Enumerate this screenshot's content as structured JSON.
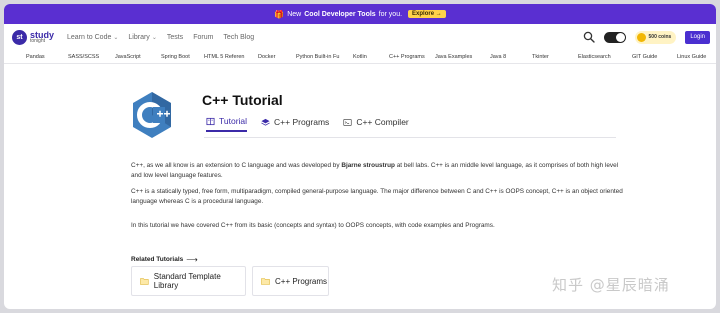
{
  "promo": {
    "prefix": "New",
    "highlight": "Cool Developer Tools",
    "suffix": "for you.",
    "button": "Explore →",
    "icon": "gift-icon"
  },
  "nav": {
    "logo_line1": "study",
    "logo_line2": "tonight",
    "logo_badge": "st",
    "links": [
      "Learn to Code",
      "Library",
      "Tests",
      "Forum",
      "Tech Blog"
    ],
    "coins": "500 coins",
    "login": "Login"
  },
  "topics": [
    "Pandas",
    "SASS/SCSS",
    "JavaScript",
    "Spring Boot",
    "HTML 5 Referen",
    "Docker",
    "Python Built-in Fu",
    "Kotlin",
    "C++ Programs",
    "Java Examples",
    "Java 8",
    "Tkinter",
    "Elasticsearch",
    "GIT Guide",
    "Linux Guide"
  ],
  "hero": {
    "title": "C++ Tutorial",
    "tabs": [
      {
        "label": "Tutorial",
        "icon": "book-icon"
      },
      {
        "label": "C++ Programs",
        "icon": "layers-icon"
      },
      {
        "label": "C++ Compiler",
        "icon": "terminal-icon"
      }
    ]
  },
  "content": {
    "p1_before": "C++, as we all know is an extension to C language and was developed by ",
    "p1_bold": "Bjarne stroustrup",
    "p1_after": " at bell labs. C++ is an middle level language, as it comprises of both high level and low level language features.",
    "p2": "C++ is a statically typed, free form, multiparadigm, compiled general-purpose language. The major difference between C and C++ is OOPS concept, C++ is an object oriented language whereas C is a procedural language.",
    "p3": "In this tutorial we have covered C++ from its basic (concepts and syntax) to OOPS concepts, with code examples and Programs."
  },
  "related": {
    "heading": "Related Tutorials",
    "cards": [
      "Standard Template Library",
      "C++ Programs"
    ]
  },
  "watermark": "知乎 @星辰暗涌",
  "colors": {
    "promo_bg": "#5a2fd1",
    "accent": "#3b2aa8",
    "explore_button": "#ffd24a",
    "login_button": "#4a2fd0",
    "cpp_logo": "#3f7fbf"
  }
}
